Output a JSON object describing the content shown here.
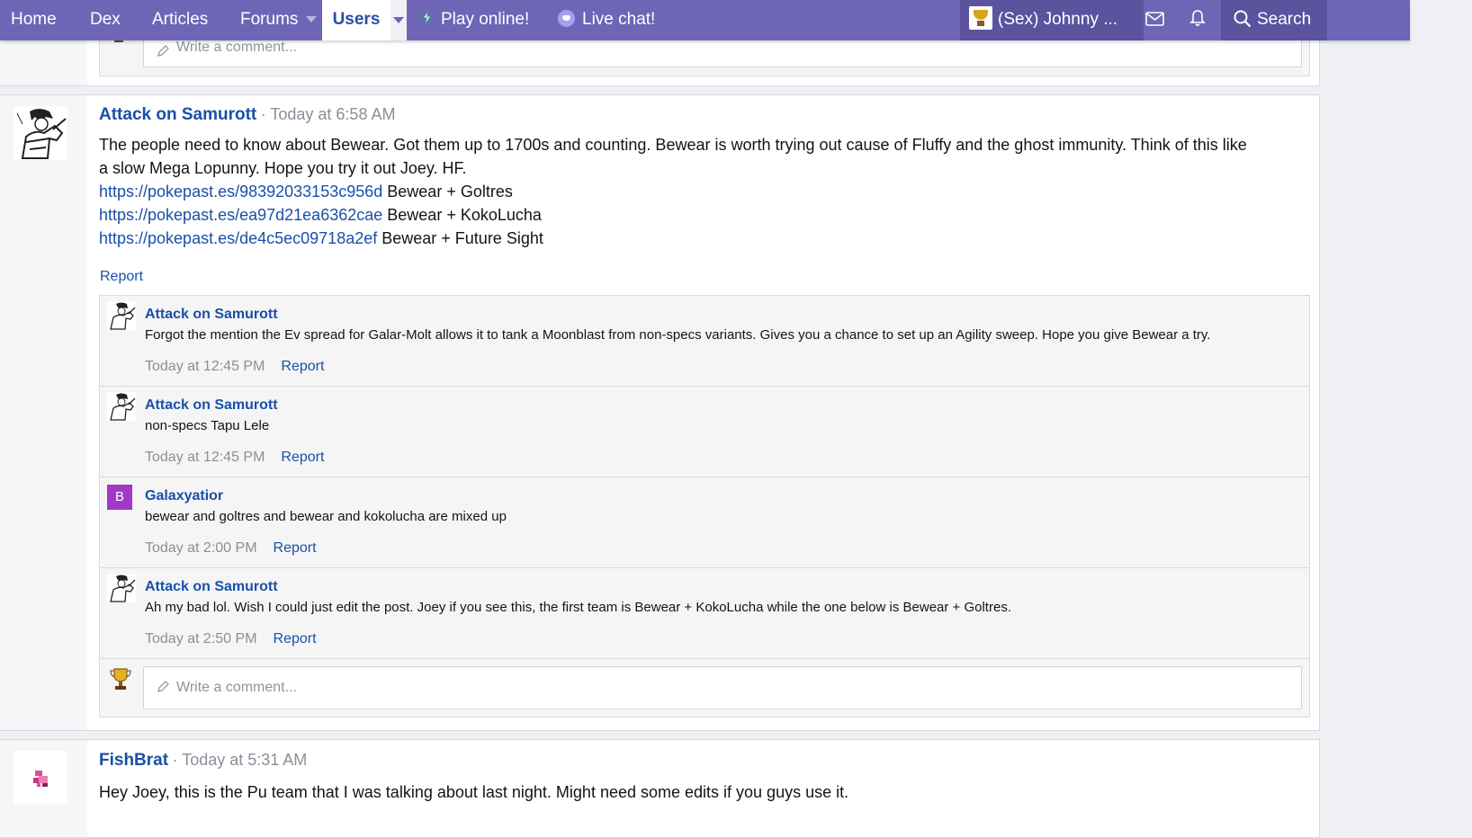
{
  "nav": {
    "home": "Home",
    "dex": "Dex",
    "articles": "Articles",
    "forums": "Forums",
    "users": "Users",
    "play": "Play online!",
    "chat": "Live chat!",
    "user": "(Sex) Johnny ...",
    "search": "Search"
  },
  "top_card": {
    "write_placeholder": "Write a comment..."
  },
  "post1": {
    "author": "Attack on Samurott",
    "time": "Today at 6:58 AM",
    "body_line1": "The people need to know about Bewear. Got them up to 1700s and counting. Bewear is worth trying out cause of Fluffy and the ghost immunity. Think of this like",
    "body_line2": "a slow Mega Lopunny. Hope you try it out Joey. HF.",
    "links": [
      {
        "url": "https://pokepast.es/98392033153c956d",
        "text": "Bewear + Goltres"
      },
      {
        "url": "https://pokepast.es/ea97d21ea6362cae",
        "text": "Bewear + KokoLucha"
      },
      {
        "url": "https://pokepast.es/de4c5ec09718a2ef",
        "text": "Bewear + Future Sight"
      }
    ],
    "report": "Report",
    "comments": [
      {
        "author": "Attack on Samurott",
        "text": "Forgot the mention the Ev spread for Galar-Molt allows it to tank a Moonblast from non-specs variants. Gives you a chance to set up an Agility sweep. Hope you give Bewear a try.",
        "time": "Today at 12:45 PM",
        "report": "Report"
      },
      {
        "author": "Attack on Samurott",
        "text": "non-specs Tapu Lele",
        "time": "Today at 12:45 PM",
        "report": "Report"
      },
      {
        "author": "Galaxyatior",
        "avatar_letter": "B",
        "text": "bewear and goltres and bewear and kokolucha are mixed up",
        "time": "Today at 2:00 PM",
        "report": "Report"
      },
      {
        "author": "Attack on Samurott",
        "text": "Ah my bad lol. Wish I could just edit the post. Joey if you see this, the first team is Bewear + KokoLucha while the one below is Bewear + Goltres.",
        "time": "Today at 2:50 PM",
        "report": "Report"
      }
    ],
    "write_placeholder": "Write a comment..."
  },
  "post2": {
    "author": "FishBrat",
    "time": "Today at 5:31 AM",
    "body": "Hey Joey, this is the Pu team that I was talking about last night. Might need some edits if you guys use it."
  },
  "colors": {
    "navbar": "#6e65b7",
    "link": "#1a4fa8",
    "letter_avatar": "#a138c8",
    "trophy": "#d6a51d"
  }
}
